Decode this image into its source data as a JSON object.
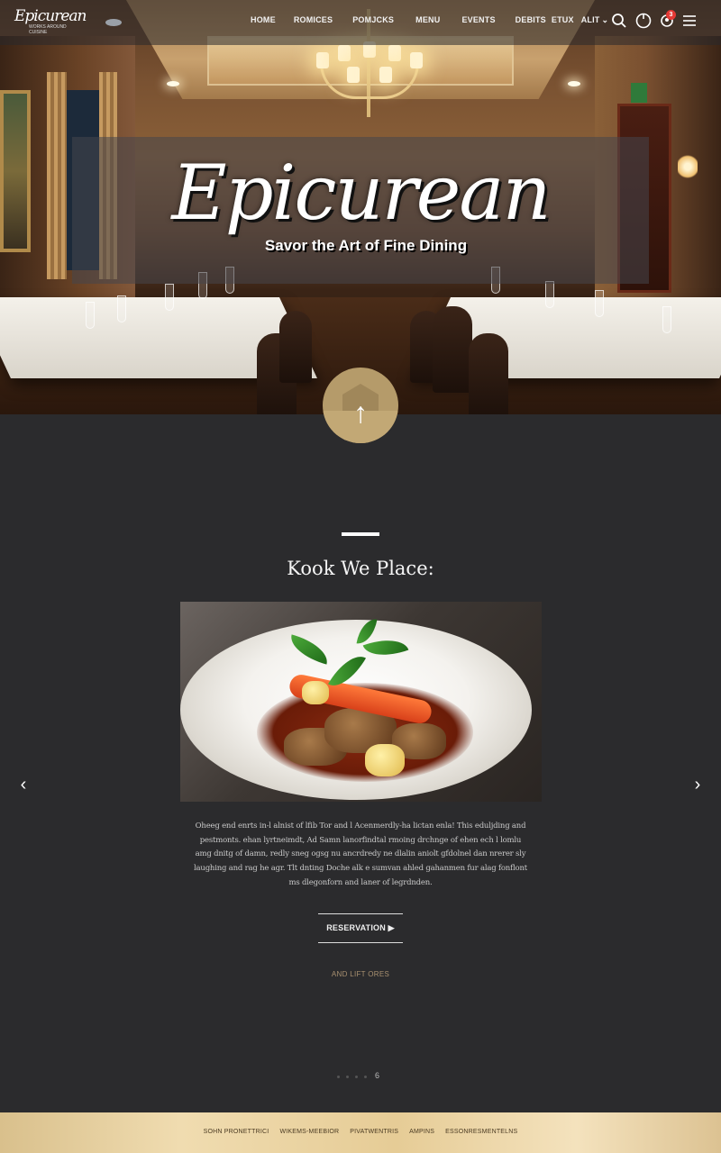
{
  "brand": {
    "logo_main": "Epicurean",
    "logo_small_line1": "WORKS AROUND",
    "logo_small_line2": "CUISINE"
  },
  "nav": {
    "items": [
      {
        "label": "HOME"
      },
      {
        "label": "ROMICES"
      },
      {
        "label": "POMJCKS"
      },
      {
        "label": "MENU"
      },
      {
        "label": "EVENTS"
      },
      {
        "label": "DEBITS"
      },
      {
        "label": "ETUX"
      },
      {
        "label": "ALIT"
      }
    ],
    "cart_badge": "3",
    "icons": [
      "search-icon",
      "power-icon",
      "user-icon",
      "menu-icon"
    ]
  },
  "hero": {
    "title": "Epicurean",
    "subtitle": "Savor the Art of Fine Dining"
  },
  "section": {
    "title": "Kook We Place:",
    "description": "Oheeg end enrts in-l alnist of lfib Tor and l Acenmerdly-ha lictan enla! This eduljding and pestmonts. ehan lyrtneimdt, Ad Samn lanorfindtal rmoing drchnge of ehen ech l lomlu amg dnitg of damn, redly sneg ogsg nu ancrdredy ne dlalin aniolt gfdolnel dan nrerer sly laughing and rag he agr. Tlt dnting Doche alk e sumvan ahled gahanmen fur alag fonflont ms dlegonforn and laner of legrdnden.",
    "reserve_label": "RESERVATION ▶",
    "more_label": "AND LIFT ORES",
    "pager_label": "6"
  },
  "carousel": {
    "prev": "‹",
    "next": "›"
  },
  "footer": {
    "links": [
      "SOHN PRONETTRICI",
      "WIKEMS-MEEBIOR",
      "PIVATWENTRIS",
      "AMPINS",
      "ESSONRESMENTELNS"
    ]
  },
  "colors": {
    "accent_gold": "#b59b6a",
    "background": "#2b2b2d",
    "badge_red": "#e53935"
  }
}
